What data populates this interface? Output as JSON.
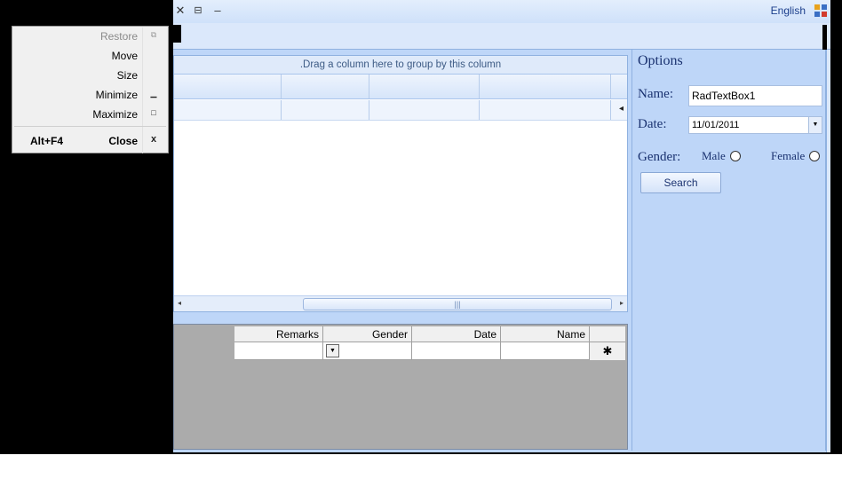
{
  "titlebar": {
    "close_glyph": "✕",
    "maximize_glyph": "⊟",
    "minimize_glyph": "–",
    "language": "English"
  },
  "grid": {
    "group_panel_text": ".Drag a column here to group by this column",
    "row_indicator": "◂",
    "scroll_left": "◂",
    "scroll_right": "▸",
    "scroll_thumb_grip": "|||"
  },
  "dgv": {
    "columns": [
      "Remarks",
      "Gender",
      "Date",
      "Name"
    ],
    "new_row_marker": "✱",
    "dropdown_arrow": "▼"
  },
  "options": {
    "title": "Options",
    "name_label": "Name:",
    "name_value": "RadTextBox1",
    "date_label": "Date:",
    "date_value": "11/01/2011",
    "date_arrow": "▼",
    "gender_label": "Gender:",
    "male_label": "Male",
    "female_label": "Female",
    "search_label": "Search"
  },
  "system_menu": {
    "items": [
      {
        "label": "Restore",
        "icon": "⧉",
        "disabled": true
      },
      {
        "label": "Move",
        "icon": ""
      },
      {
        "label": "Size",
        "icon": ""
      },
      {
        "label": "Minimize",
        "icon": "▁"
      },
      {
        "label": "Maximize",
        "icon": "□"
      }
    ],
    "close": {
      "label": "Close",
      "shortcut": "Alt+F4",
      "icon": "x"
    }
  },
  "colors": {
    "window_bg": "#bed6f8",
    "accent_text": "#1a3270"
  }
}
